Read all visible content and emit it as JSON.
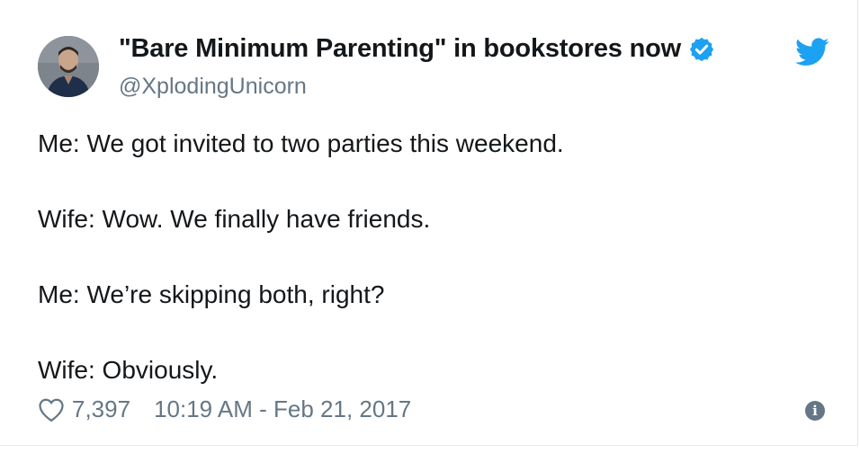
{
  "author": {
    "display_name": "\"Bare Minimum Parenting\" in bookstores now",
    "username": "@XplodingUnicorn",
    "verified": true
  },
  "icons": {
    "brand": "twitter-bird-icon",
    "verified": "verified-badge-icon",
    "like": "heart-icon",
    "info": "info-icon"
  },
  "colors": {
    "twitter_blue": "#1da1f2",
    "text_primary": "#14171a",
    "text_secondary": "#657786"
  },
  "tweet": {
    "lines": [
      "Me: We got invited to two parties this weekend.",
      "Wife: Wow. We finally have friends.",
      "Me: We’re skipping both, right?",
      "Wife: Obviously."
    ]
  },
  "footer": {
    "like_count": "7,397",
    "timestamp": "10:19 AM - Feb 21, 2017",
    "info_glyph": "i"
  }
}
